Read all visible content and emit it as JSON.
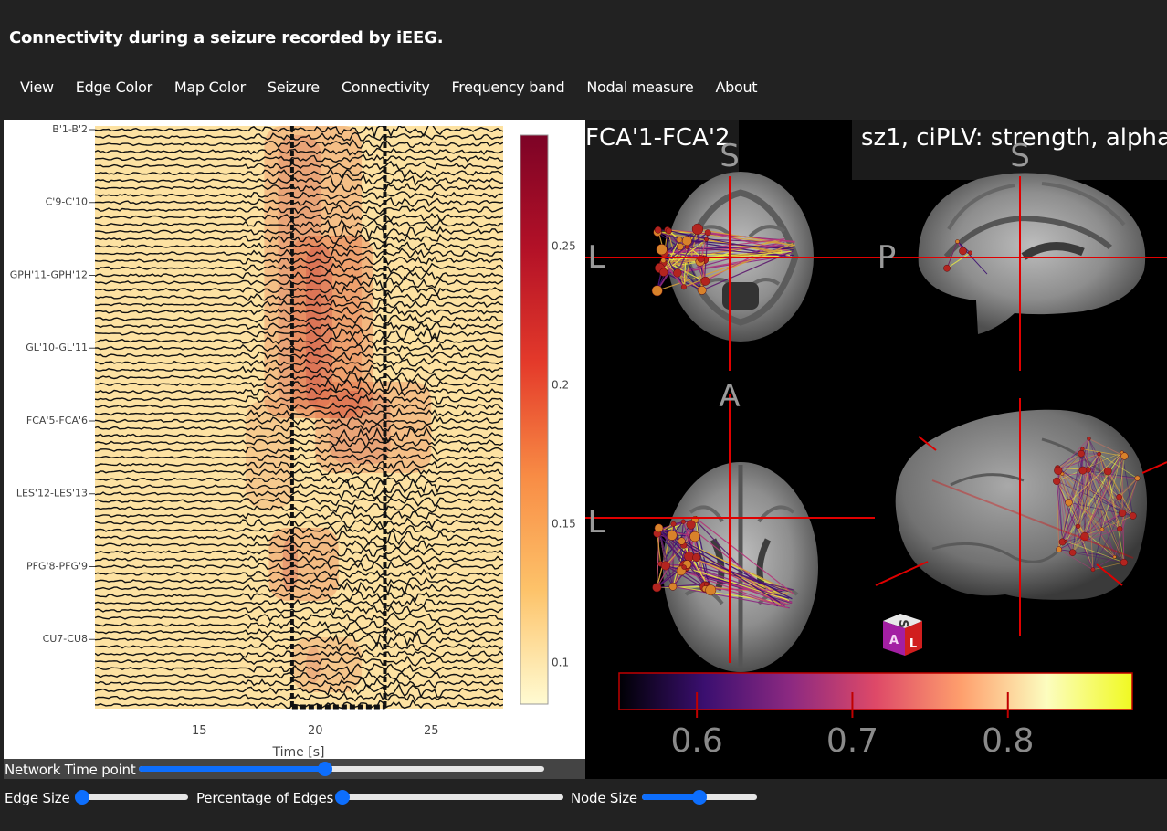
{
  "app": {
    "title": "Connectivity during a seizure recorded by iEEG."
  },
  "menu": [
    "View",
    "Edge Color",
    "Map Color",
    "Seizure",
    "Connectivity",
    "Frequency band",
    "Nodal measure",
    "About"
  ],
  "eeg_plot": {
    "channel_labels": [
      "B'1-B'2",
      "C'9-C'10",
      "GPH'11-GPH'12",
      "GL'10-GL'11",
      "FCA'5-FCA'6",
      "LES'12-LES'13",
      "PFG'8-PFG'9",
      "CU7-CU8"
    ],
    "xlabel": "Time [s]",
    "x_ticks": [
      15,
      20,
      25
    ],
    "xlim": [
      10.5,
      28.1
    ],
    "markers": [
      19,
      23
    ],
    "colorbar": {
      "ticks": [
        0.25,
        0.2,
        0.15,
        0.1
      ],
      "range": [
        0.085,
        0.29
      ],
      "colors": [
        "#fffbd2",
        "#fdc36a",
        "#f88c45",
        "#e43a2a",
        "#b31127",
        "#7d0326"
      ]
    }
  },
  "brain": {
    "electrode_label": "FCA'1-FCA'2",
    "info_text": "sz1, ciPLV: strength, alpha",
    "orientation_letters": {
      "sup1": "S",
      "sup2": "S",
      "left1": "L",
      "post": "P",
      "ant": "A",
      "left2": "L"
    },
    "cube_letters": [
      "S",
      "A",
      "L"
    ],
    "colorbar": {
      "ticks": [
        "0.6",
        "0.7",
        "0.8"
      ],
      "range": [
        0.55,
        0.88
      ],
      "colors": [
        "#000004",
        "#3b0f70",
        "#8c2981",
        "#de4968",
        "#fe9f6d",
        "#fcfdbf",
        "#f0f921"
      ]
    }
  },
  "controls": {
    "time_label": "Network Time point",
    "time_value": 0.46,
    "edge_size_label": "Edge Size",
    "edge_size_value": 0.02,
    "percent_edges_label": "Percentage of Edges",
    "percent_edges_value": 0.02,
    "node_size_label": "Node Size",
    "node_size_value": 0.5
  }
}
